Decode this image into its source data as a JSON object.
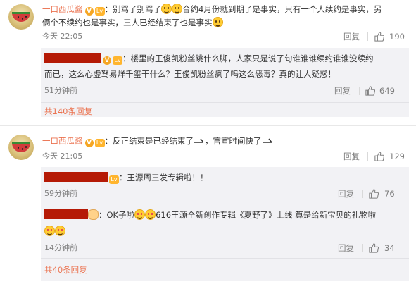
{
  "comments": [
    {
      "username": "一口西瓜酱",
      "text_1": "：别骂了别骂了",
      "text_2": "合约4月份就到期了是事实，只有一个人续约是事实，另",
      "text_3": "俩个不续约也是事实，三人已经结束了也是事实",
      "time": "今天 22:05",
      "reply_label": "回复",
      "likes": "190",
      "replies": [
        {
          "text_1": "：楼里的王俊凯粉丝跳什么脚，人家只是说了句谁谁谁续约谁谁没续约",
          "text_2": "而已，这么心虚驽易烊千玺干什么？王俊凯粉丝疯了吗这么恶毒？真的让人疑惑！",
          "time": "51分钟前",
          "reply_label": "回复",
          "likes": "649"
        }
      ],
      "more_replies": "共140条回复"
    },
    {
      "username": "一口西瓜酱",
      "text_1": "：反正结束是已经结束了",
      "text_2": "，官宣时间快了",
      "time": "今天 21:05",
      "reply_label": "回复",
      "likes": "129",
      "replies": [
        {
          "text_1": "：王源周三发专辑啦！！",
          "time": "59分钟前",
          "reply_label": "回复",
          "likes": "76"
        },
        {
          "text_1": "：OK子啦",
          "text_2": "616王源全新创作专辑《夏野了》上线 算是给新宝贝的礼物啦",
          "time": "14分钟前",
          "reply_label": "回复",
          "likes": "34"
        }
      ],
      "more_replies": "共40条回复"
    }
  ],
  "icons": {
    "vip": "V",
    "level": "Lv",
    "thumb": "thumbs-up-icon",
    "emoji": "smile-emoji-icon",
    "arrow": "arrow-emoji-icon"
  },
  "colors": {
    "username": "#eb7350",
    "redaction": "#b51a06",
    "subbox_bg": "#f2f2f5",
    "meta": "#808080"
  }
}
